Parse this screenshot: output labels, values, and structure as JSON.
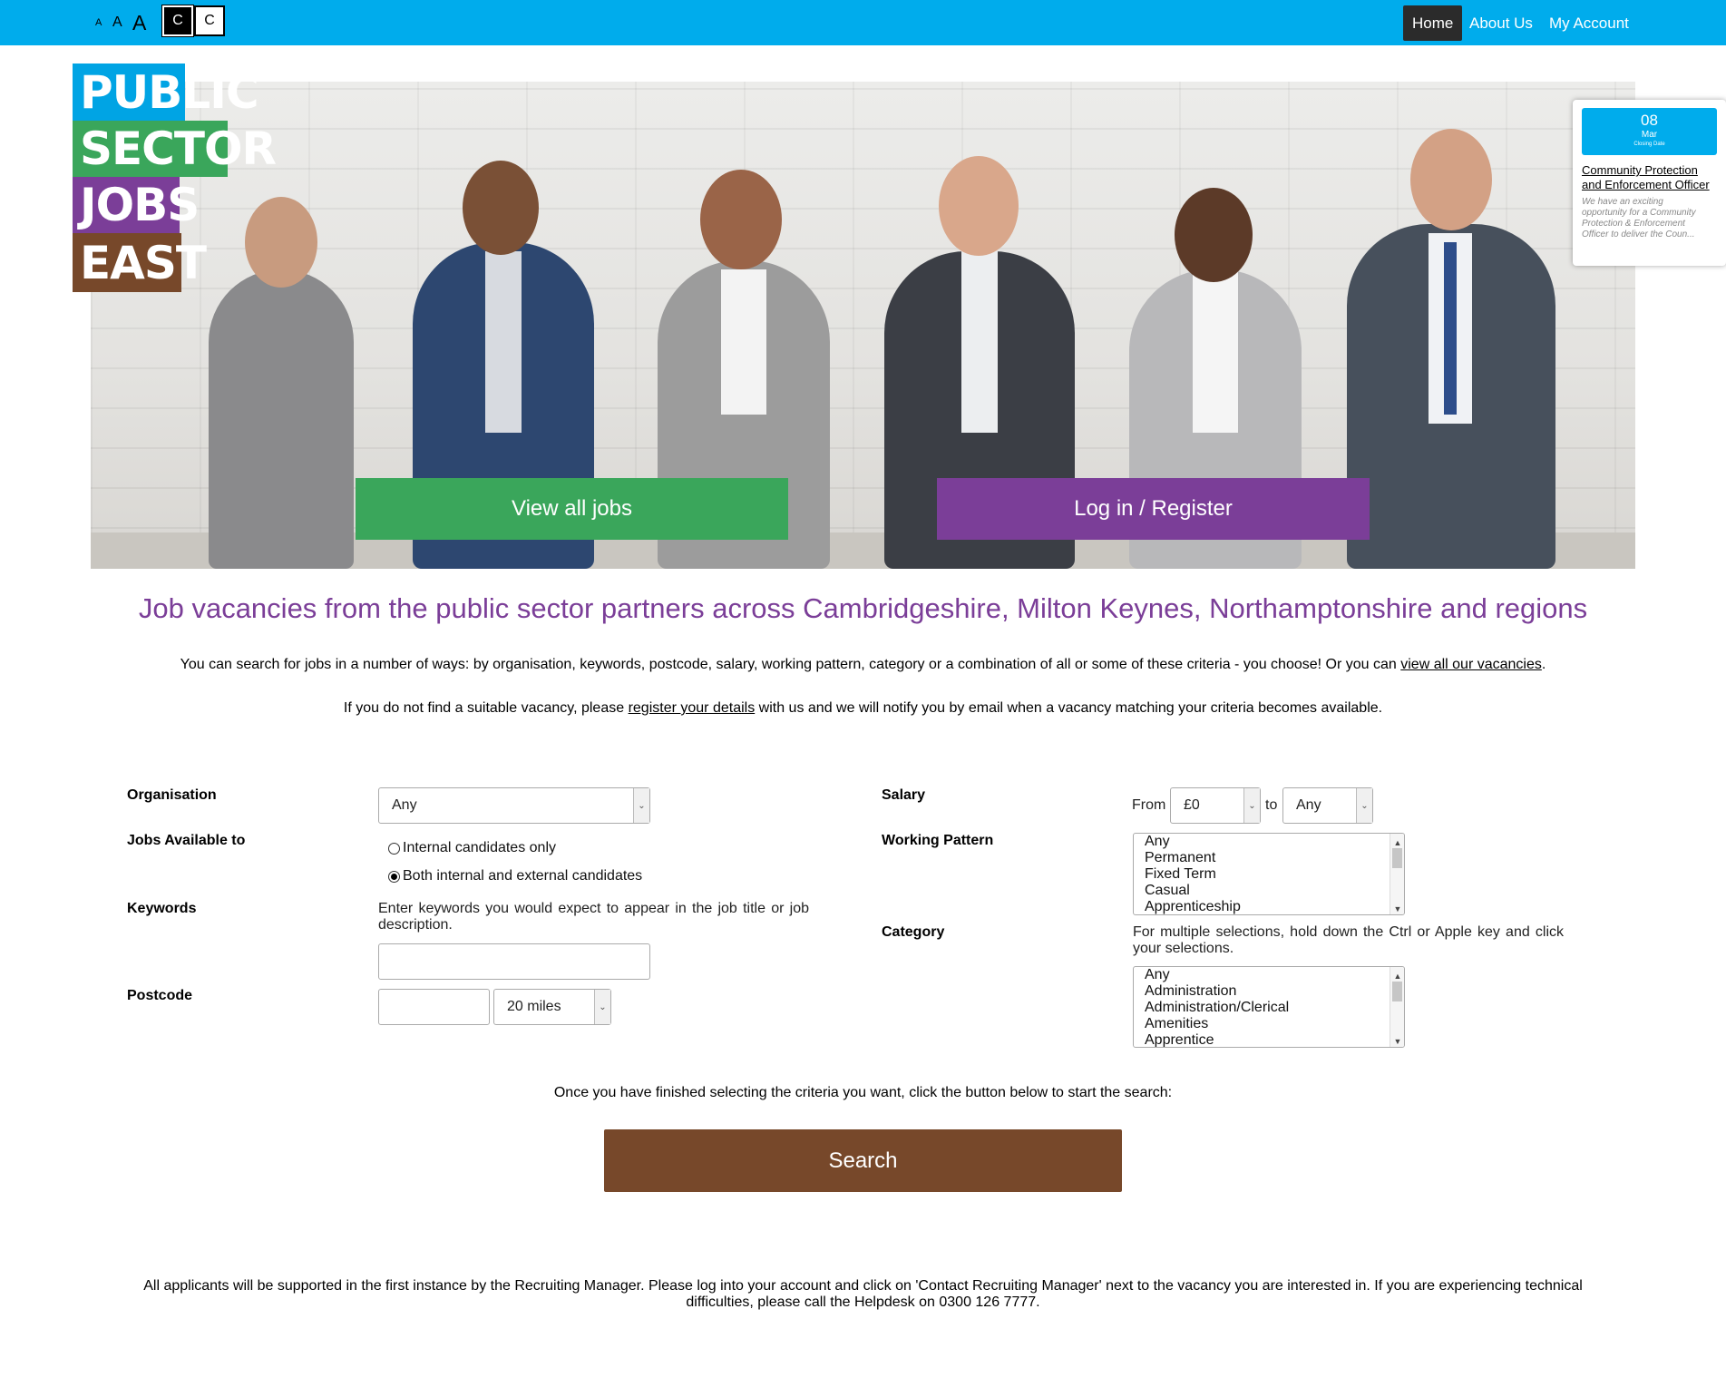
{
  "topbar": {
    "font_small": "A",
    "font_medium": "A",
    "font_large": "A",
    "contrast_dark": "C",
    "contrast_light": "C",
    "nav": {
      "home": "Home",
      "about": "About Us",
      "account": "My Account"
    }
  },
  "logo": {
    "line1": "PUBLIC",
    "line2": "SECTOR",
    "line3": "JOBS",
    "line4": "EAST"
  },
  "hero": {
    "view_all_jobs": "View all jobs",
    "login_register": "Log in / Register"
  },
  "featured_job": {
    "day": "08",
    "month": "Mar",
    "closing_label": "Closing Date",
    "title": "Community Protection and Enforcement Officer",
    "description": "We have an exciting opportunity for a Community Protection & Enforcement Officer to deliver the Coun..."
  },
  "headline": "Job vacancies from the public sector partners across Cambridgeshire, Milton Keynes, Northamptonshire and regions",
  "intro": {
    "line1_text": "You can search for jobs in a number of ways: by organisation, keywords, postcode, salary, working pattern, category or a combination of all or some of these criteria - you choose! Or you can ",
    "line1_link": "view all our vacancies",
    "line1_end": ".",
    "line2_start": "If you do not find a suitable vacancy, please ",
    "line2_link": "register your details",
    "line2_end": " with us and we will notify you by email when a vacancy matching your criteria becomes available."
  },
  "form": {
    "organisation_label": "Organisation",
    "organisation_value": "Any",
    "jobs_available_label": "Jobs Available to",
    "radio_internal": "Internal candidates only",
    "radio_both": "Both internal and external candidates",
    "keywords_label": "Keywords",
    "keywords_help": "Enter keywords you would expect to appear in the job title or job description.",
    "keywords_value": "",
    "postcode_label": "Postcode",
    "postcode_value": "",
    "distance_value": "20 miles",
    "salary_label": "Salary",
    "salary_from": "From",
    "salary_from_value": "£0",
    "salary_to": "to",
    "salary_to_value": "Any",
    "working_pattern_label": "Working Pattern",
    "working_pattern_options": [
      "Any",
      "Permanent",
      "Fixed Term",
      "Casual",
      "Apprenticeship"
    ],
    "category_label": "Category",
    "category_help": "For multiple selections, hold down the Ctrl or Apple key and click your selections.",
    "category_options": [
      "Any",
      "Administration",
      "Administration/Clerical",
      "Amenities",
      "Apprentice"
    ]
  },
  "finish_text": "Once you have finished selecting the criteria you want, click the button below to start the search:",
  "search_button": "Search",
  "footer": "All applicants will be supported in the first instance by the Recruiting Manager. Please log into your account and click on 'Contact Recruiting Manager' next to the vacancy you are interested in. If you are experiencing technical difficulties, please call the Helpdesk on 0300 126 7777.",
  "colors": {
    "topbar": "#00acec",
    "green": "#3aa65b",
    "purple": "#7b3e98",
    "brown": "#77482a",
    "blue": "#00a4e4"
  }
}
